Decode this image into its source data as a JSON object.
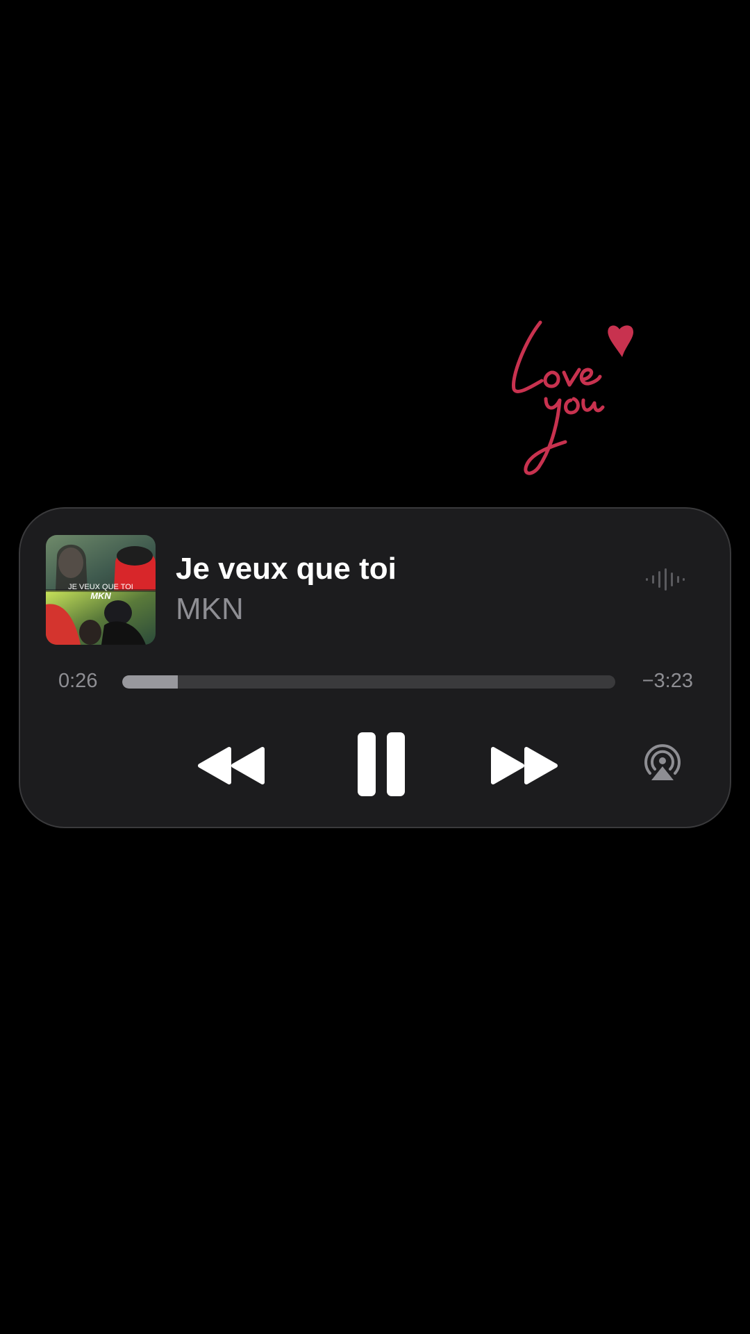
{
  "sticker": {
    "text": "Love you",
    "color": "#c8324f"
  },
  "now_playing": {
    "title": "Je veux que toi",
    "artist": "MKN",
    "artwork": {
      "overlay_text": "JE VEUX QUE TOI",
      "overlay_logo": "MKN"
    },
    "progress": {
      "elapsed": "0:26",
      "remaining": "−3:23",
      "fraction": 0.113
    },
    "icons": {
      "waveform": "waveform-icon",
      "rewind": "rewind-icon",
      "pause": "pause-icon",
      "forward": "fast-forward-icon",
      "airplay": "airplay-icon"
    }
  },
  "colors": {
    "background": "#000000",
    "card": "#1c1c1e",
    "title": "#ffffff",
    "secondary": "#8e8e93"
  }
}
